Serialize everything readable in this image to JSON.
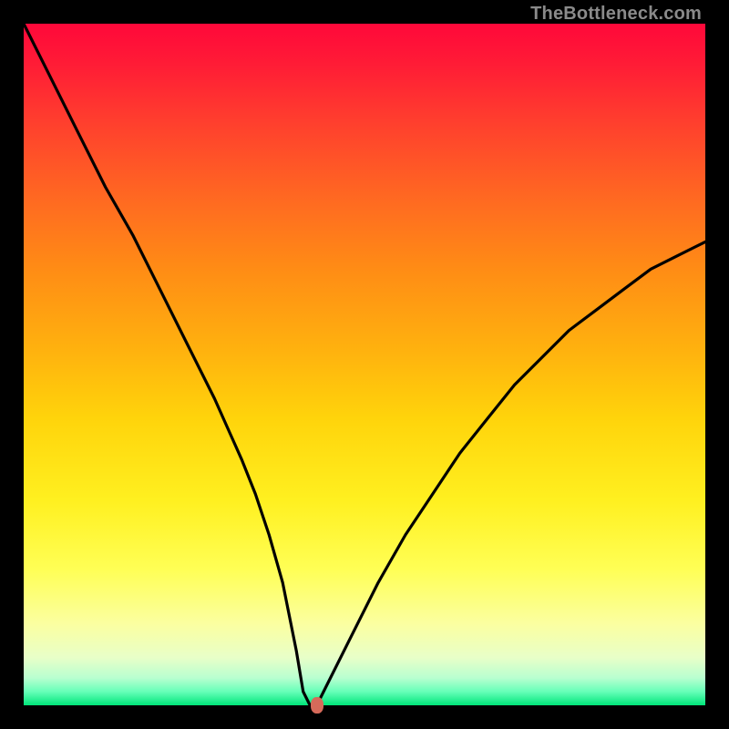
{
  "watermark": "TheBottleneck.com",
  "colors": {
    "frame": "#000000",
    "dot": "#d66a5a",
    "curve": "#000000"
  },
  "chart_data": {
    "type": "line",
    "title": "",
    "xlabel": "",
    "ylabel": "",
    "xlim": [
      0,
      100
    ],
    "ylim": [
      0,
      100
    ],
    "grid": false,
    "legend": false,
    "x": [
      0,
      4,
      8,
      12,
      16,
      20,
      24,
      28,
      32,
      34,
      36,
      38,
      40,
      41,
      42,
      43,
      44,
      48,
      52,
      56,
      60,
      64,
      68,
      72,
      76,
      80,
      84,
      88,
      92,
      96,
      100
    ],
    "values": [
      100,
      92,
      84,
      76,
      69,
      61,
      53,
      45,
      36,
      31,
      25,
      18,
      8,
      2,
      0,
      0,
      2,
      10,
      18,
      25,
      31,
      37,
      42,
      47,
      51,
      55,
      58,
      61,
      64,
      66,
      68
    ],
    "minimum_plateau": {
      "x_start": 41,
      "x_end": 43,
      "y": 0
    },
    "marker": {
      "x": 43,
      "y": 0
    }
  }
}
